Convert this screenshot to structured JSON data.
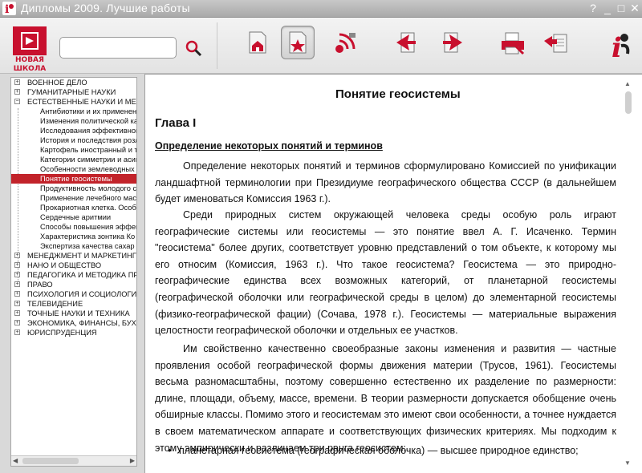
{
  "window": {
    "title": "Дипломы 2009. Лучшие работы",
    "help": "?",
    "minimize": "_",
    "maximize": "□",
    "close": "✕"
  },
  "toolbar": {
    "brand_text_1": "НОВАЯ",
    "brand_text_2": "ШКОЛА",
    "search_value": "",
    "icons": [
      "home-doc-icon",
      "bookmark-doc-icon",
      "signal-icon",
      "back-arrow-icon",
      "forward-arrow-icon",
      "print-icon",
      "export-icon",
      "publisher-logo-icon"
    ],
    "active_button": "bookmark-doc-icon",
    "accent": "#c8102e"
  },
  "tree": {
    "items": [
      {
        "label": "ВОЕННОЕ ДЕЛО",
        "level": 0,
        "expander": "+"
      },
      {
        "label": "ГУМАНИТАРНЫЕ НАУКИ",
        "level": 0,
        "expander": "+"
      },
      {
        "label": "ЕСТЕСТВЕННЫЕ НАУКИ И МЕ...",
        "level": 0,
        "expander": "−"
      },
      {
        "label": "Антибиотики и их применен",
        "level": 1
      },
      {
        "label": "Изменения политической ка",
        "level": 1
      },
      {
        "label": "Исследования эффективной",
        "level": 1
      },
      {
        "label": "История и последствия розл",
        "level": 1
      },
      {
        "label": "Картофель иностранный и т",
        "level": 1
      },
      {
        "label": "Категории симметрии и асим",
        "level": 1
      },
      {
        "label": "Особенности землеводных",
        "level": 1
      },
      {
        "label": "Понятие геосистемы",
        "level": 1,
        "selected": true
      },
      {
        "label": "Продуктивность молодого с",
        "level": 1
      },
      {
        "label": "Применение лечебного мас",
        "level": 1
      },
      {
        "label": "Прокариотная клетка. Особ",
        "level": 1
      },
      {
        "label": "Сердечные аритмии",
        "level": 1
      },
      {
        "label": "Способы повышения эффек",
        "level": 1
      },
      {
        "label": "Характеристика зонтика Ко",
        "level": 1
      },
      {
        "label": "Экспертиза качества сахар",
        "level": 1
      },
      {
        "label": "МЕНЕДЖМЕНТ И МАРКЕТИНГ",
        "level": 0,
        "expander": "+"
      },
      {
        "label": "НАНО И ОБЩЕСТВО",
        "level": 0,
        "expander": "+"
      },
      {
        "label": "ПЕДАГОГИКА И МЕТОДИКА ПР",
        "level": 0,
        "expander": "+"
      },
      {
        "label": "ПРАВО",
        "level": 0,
        "expander": "+"
      },
      {
        "label": "ПСИХОЛОГИЯ И СОЦИОЛОГИЯ",
        "level": 0,
        "expander": "+"
      },
      {
        "label": "ТЕЛЕВИДЕНИЕ",
        "level": 0,
        "expander": "+"
      },
      {
        "label": "ТОЧНЫЕ НАУКИ И ТЕХНИКА",
        "level": 0,
        "expander": "+"
      },
      {
        "label": "ЭКОНОМИКА, ФИНАНСЫ, БУХ",
        "level": 0,
        "expander": "+"
      },
      {
        "label": "ЮРИСПРУДЕНЦИЯ",
        "level": 0,
        "expander": "+"
      }
    ],
    "selected_color": "#c2232a"
  },
  "document": {
    "title": "Понятие геосистемы",
    "chapter": "Глава I",
    "section": "Определение некоторых понятий и терминов",
    "p1": "Определение некоторых понятий и терминов сформулировано Комиссией по унификации ландшафтной терминологии при Президиуме географического общества СССР (в дальнейшем будет именоваться Комиссия 1963 г.).",
    "p2": "Среди природных систем окружающей человека среды особую роль играют географические системы или геосистемы — это понятие ввел А. Г. Исаченко. Термин \"геосистема\" более других, соответствует уровню представлений о том объекте, к которому мы его относим (Комиссия, 1963 г.). Что такое геосистема? Геосистема — это природно-географические единства всех возможных категорий, от планетарной геосистемы (географической оболочки или географической среды в целом) до элементарной геосистемы (физико-географической фации) (Сочава, 1978 г.). Геосистемы — материальные выражения целостности географической оболочки и отдельных ее участков.",
    "p3": "Им свойственно качественно своеобразные законы изменения и развития — частные проявления особой географической формы движения материи (Трусов, 1961). Геосистемы весьма разномасштабны, поэтому совершенно естественно их разделение по размерности: длине, площади, объему, массе, времени. В теории размерности допускается обобщение очень обширные классы. Помимо этого и геосистемам это имеют свои особенности, а точнее нуждается в своем математическом аппарате и соответствующих физических критериях. Мы подходим к этому эмпирически и различаем три ранга геосистем:",
    "bullet": "планетарная геосистема (географическая оболочка) — высшее природное единство;"
  }
}
